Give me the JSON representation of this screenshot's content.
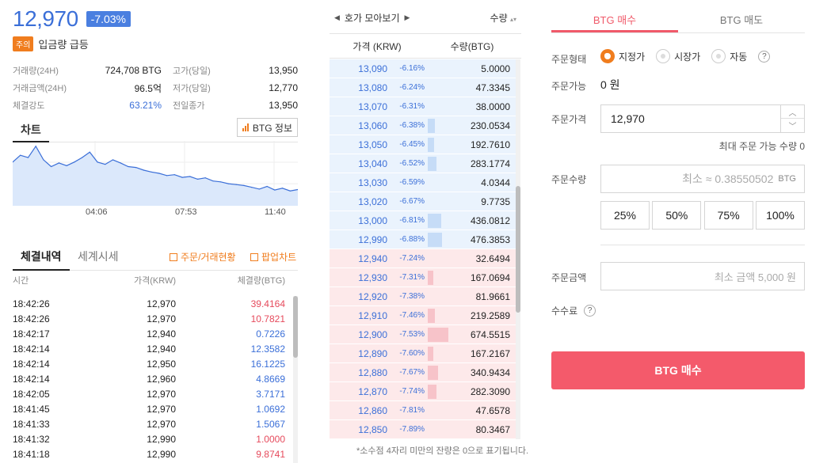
{
  "ticker": {
    "price": "12,970",
    "change_pct": "-7.03%",
    "alert_badge": "주의",
    "alert_text": "입금량 급등"
  },
  "stats": [
    {
      "l1": "거래량(24H)",
      "v1": "724,708 BTG",
      "l2": "고가(당일)",
      "v2": "13,950"
    },
    {
      "l1": "거래금액(24H)",
      "v1": "96.5억",
      "l2": "저가(당일)",
      "v2": "12,770"
    },
    {
      "l1": "체결강도",
      "v1": "63.21%",
      "l2": "전일종가",
      "v2": "13,950"
    }
  ],
  "chart": {
    "tab_label": "차트",
    "info_button": "BTG 정보",
    "time_labels": [
      "04:06",
      "07:53",
      "11:40"
    ]
  },
  "chart_data": {
    "type": "area",
    "x": [
      "",
      "",
      "",
      "",
      "",
      "",
      "",
      "",
      "",
      "",
      "",
      "",
      "",
      "",
      "",
      "",
      "",
      "",
      "",
      "",
      "",
      "",
      "",
      "",
      "",
      "",
      "",
      "",
      "",
      "",
      "",
      "",
      "",
      "",
      "",
      "",
      "",
      ""
    ],
    "values": [
      13600,
      13750,
      13700,
      13950,
      13650,
      13500,
      13580,
      13520,
      13600,
      13700,
      13820,
      13600,
      13550,
      13650,
      13580,
      13500,
      13480,
      13420,
      13380,
      13350,
      13300,
      13320,
      13260,
      13280,
      13220,
      13250,
      13180,
      13160,
      13120,
      13100,
      13080,
      13040,
      13000,
      13060,
      12980,
      13020,
      12960,
      12990
    ],
    "ylim": [
      12700,
      14000
    ],
    "grid": true,
    "color": "#3b6fd8",
    "fill": "#dbe8fb"
  },
  "trades": {
    "tab_active": "체결내역",
    "tab_inactive": "세계시세",
    "link1": "주문/거래현황",
    "link2": "팝업차트",
    "headers": [
      "시간",
      "가격(KRW)",
      "체결량(BTG)"
    ],
    "rows": [
      {
        "time": "18:42:26",
        "price": "12,970",
        "qty": "39.4164",
        "side": "buy"
      },
      {
        "time": "18:42:26",
        "price": "12,970",
        "qty": "10.7821",
        "side": "buy"
      },
      {
        "time": "18:42:17",
        "price": "12,940",
        "qty": "0.7226",
        "side": "sell"
      },
      {
        "time": "18:42:14",
        "price": "12,940",
        "qty": "12.3582",
        "side": "sell"
      },
      {
        "time": "18:42:14",
        "price": "12,950",
        "qty": "16.1225",
        "side": "sell"
      },
      {
        "time": "18:42:14",
        "price": "12,960",
        "qty": "4.8669",
        "side": "sell"
      },
      {
        "time": "18:42:05",
        "price": "12,970",
        "qty": "3.7171",
        "side": "sell"
      },
      {
        "time": "18:41:45",
        "price": "12,970",
        "qty": "1.0692",
        "side": "sell"
      },
      {
        "time": "18:41:33",
        "price": "12,970",
        "qty": "1.5067",
        "side": "sell"
      },
      {
        "time": "18:41:32",
        "price": "12,990",
        "qty": "1.0000",
        "side": "buy"
      },
      {
        "time": "18:41:18",
        "price": "12,990",
        "qty": "9.8741",
        "side": "buy"
      }
    ]
  },
  "orderbook": {
    "group_label": "호가 모아보기",
    "qty_label": "수량",
    "header_price": "가격 (KRW)",
    "header_qty": "수량(BTG)",
    "note": "*소수점 4자리 미만의 잔량은 0으로 표기됩니다.",
    "asks": [
      {
        "price": "13,090",
        "pct": "-6.16%",
        "qty": "5.0000",
        "depth": 0.0
      },
      {
        "price": "13,080",
        "pct": "-6.24%",
        "qty": "47.3345",
        "depth": 0.0
      },
      {
        "price": "13,070",
        "pct": "-6.31%",
        "qty": "38.0000",
        "depth": 0.0
      },
      {
        "price": "13,060",
        "pct": "-6.38%",
        "qty": "230.0534",
        "depth": 0.34
      },
      {
        "price": "13,050",
        "pct": "-6.45%",
        "qty": "192.7610",
        "depth": 0.29
      },
      {
        "price": "13,040",
        "pct": "-6.52%",
        "qty": "283.1774",
        "depth": 0.42
      },
      {
        "price": "13,030",
        "pct": "-6.59%",
        "qty": "4.0344",
        "depth": 0.0
      },
      {
        "price": "13,020",
        "pct": "-6.67%",
        "qty": "9.7735",
        "depth": 0.0
      },
      {
        "price": "13,000",
        "pct": "-6.81%",
        "qty": "436.0812",
        "depth": 0.65
      },
      {
        "price": "12,990",
        "pct": "-6.88%",
        "qty": "476.3853",
        "depth": 0.71
      }
    ],
    "bids": [
      {
        "price": "12,940",
        "pct": "-7.24%",
        "qty": "32.6494",
        "depth": 0.0
      },
      {
        "price": "12,930",
        "pct": "-7.31%",
        "qty": "167.0694",
        "depth": 0.25
      },
      {
        "price": "12,920",
        "pct": "-7.38%",
        "qty": "81.9661",
        "depth": 0.0
      },
      {
        "price": "12,910",
        "pct": "-7.46%",
        "qty": "219.2589",
        "depth": 0.33
      },
      {
        "price": "12,900",
        "pct": "-7.53%",
        "qty": "674.5515",
        "depth": 1.0
      },
      {
        "price": "12,890",
        "pct": "-7.60%",
        "qty": "167.2167",
        "depth": 0.25
      },
      {
        "price": "12,880",
        "pct": "-7.67%",
        "qty": "340.9434",
        "depth": 0.51
      },
      {
        "price": "12,870",
        "pct": "-7.74%",
        "qty": "282.3090",
        "depth": 0.42
      },
      {
        "price": "12,860",
        "pct": "-7.81%",
        "qty": "47.6578",
        "depth": 0.0
      },
      {
        "price": "12,850",
        "pct": "-7.89%",
        "qty": "80.3467",
        "depth": 0.0
      }
    ]
  },
  "form": {
    "tab_buy": "BTG 매수",
    "tab_sell": "BTG 매도",
    "order_type_label": "주문형태",
    "types": [
      "지정가",
      "시장가",
      "자동"
    ],
    "available_label": "주문가능",
    "available_value": "0  원",
    "price_label": "주문가격",
    "price_value": "12,970",
    "max_note": "최대 주문 가능 수량  0",
    "qty_label": "주문수량",
    "qty_placeholder": "최소 ≈ 0.38550502",
    "qty_unit": "BTG",
    "pct_buttons": [
      "25%",
      "50%",
      "75%",
      "100%"
    ],
    "amount_label": "주문금액",
    "amount_placeholder": "최소 금액 5,000  원",
    "fee_label": "수수료",
    "buy_button": "BTG 매수"
  },
  "colors": {
    "up": "#e64a5c",
    "down": "#3b6fd8",
    "accent": "#f07d1e",
    "buy": "#f45a6b"
  }
}
